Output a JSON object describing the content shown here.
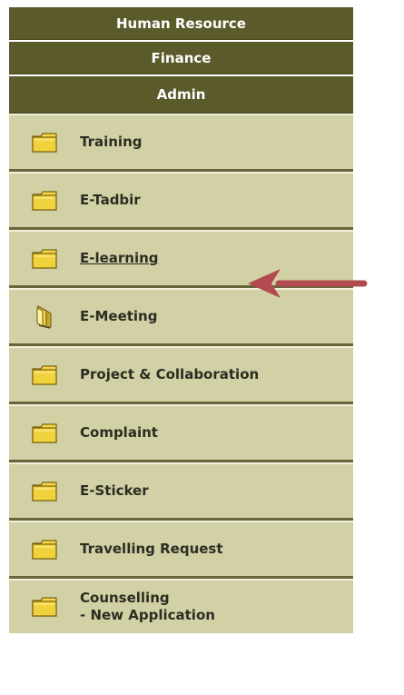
{
  "menu": {
    "headers": {
      "human_resource": "Human Resource",
      "finance": "Finance",
      "admin": "Admin"
    },
    "items": [
      {
        "label": "Training",
        "icon": "folder-icon"
      },
      {
        "label": "E-Tadbir",
        "icon": "folder-icon"
      },
      {
        "label": "E-learning",
        "icon": "folder-icon",
        "underlined": true
      },
      {
        "label": "E-Meeting",
        "icon": "open-folder-icon"
      },
      {
        "label": "Project & Collaboration",
        "icon": "folder-icon"
      },
      {
        "label": "Complaint",
        "icon": "folder-icon"
      },
      {
        "label": "E-Sticker",
        "icon": "folder-icon"
      },
      {
        "label": "Travelling Request",
        "icon": "folder-icon"
      },
      {
        "label": "Counselling\n- New Application",
        "icon": "folder-icon"
      }
    ]
  },
  "colors": {
    "header_bg": "#5b5a2b",
    "item_bg": "#d2d1a6",
    "arrow": "#b24a4f"
  }
}
